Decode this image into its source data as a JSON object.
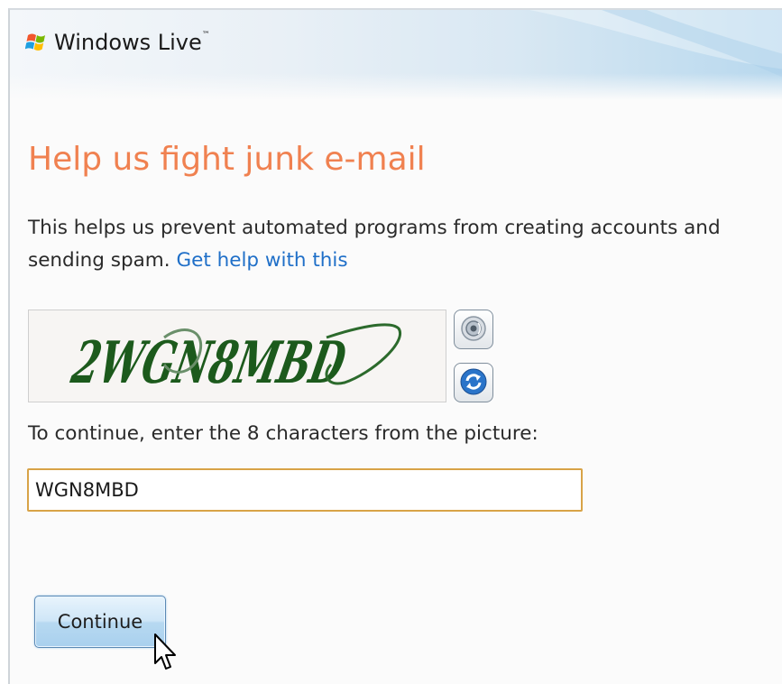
{
  "header": {
    "brand_name": "Windows Live",
    "brand_tm": "™",
    "logo_icon": "windows-flag-icon"
  },
  "main": {
    "title": "Help us fight junk e-mail",
    "description": "This helps us prevent automated programs from creating accounts and sending spam.",
    "help_link": "Get help with this",
    "captcha_text": "2WGN8MBD",
    "audio_icon": "speaker-icon",
    "refresh_icon": "refresh-icon",
    "prompt": "To continue, enter the 8 characters from the picture:",
    "answer_value": "WGN8MBD",
    "continue_label": "Continue"
  },
  "colors": {
    "title": "#f08150",
    "link": "#1f6fc8",
    "captcha_ink": "#1c5a1c",
    "input_border": "#d8a347",
    "button_top": "#e8f4fc",
    "button_bottom": "#a9d0ee"
  }
}
